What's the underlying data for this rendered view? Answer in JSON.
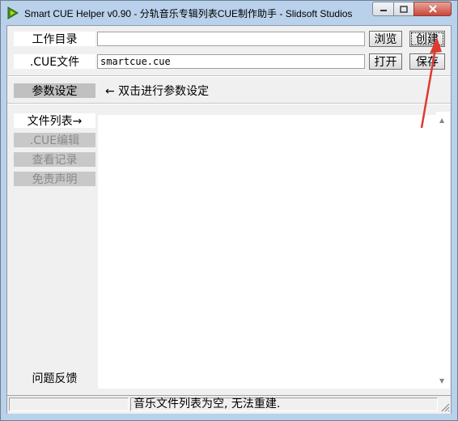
{
  "window": {
    "title": "Smart CUE Helper v0.90 - 分轨音乐专辑列表CUE制作助手 - Slidsoft Studios",
    "icon": "app-logo-icon"
  },
  "form": {
    "workdir_label": "工作目录",
    "workdir_value": "",
    "browse_label": "浏览",
    "create_label": "创建",
    "cuefile_label": ".CUE文件",
    "cuefile_value": "smartcue.cue",
    "open_label": "打开",
    "save_label": "保存"
  },
  "params": {
    "button_label": "参数设定",
    "hint": "← 双击进行参数设定"
  },
  "sidebar": {
    "items": [
      {
        "label": "文件列表→",
        "state": "active"
      },
      {
        "label": ".CUE编辑",
        "state": "disabled"
      },
      {
        "label": "查看记录",
        "state": "disabled"
      },
      {
        "label": "免责声明",
        "state": "disabled"
      }
    ],
    "feedback_label": "问题反馈"
  },
  "status": {
    "pane1": "",
    "message": "音乐文件列表为空, 无法重建."
  },
  "colors": {
    "annotation_arrow": "#e03a2f",
    "disabled_tab_bg": "#c8c8c8",
    "param_button_bg": "#c0c0c0"
  }
}
